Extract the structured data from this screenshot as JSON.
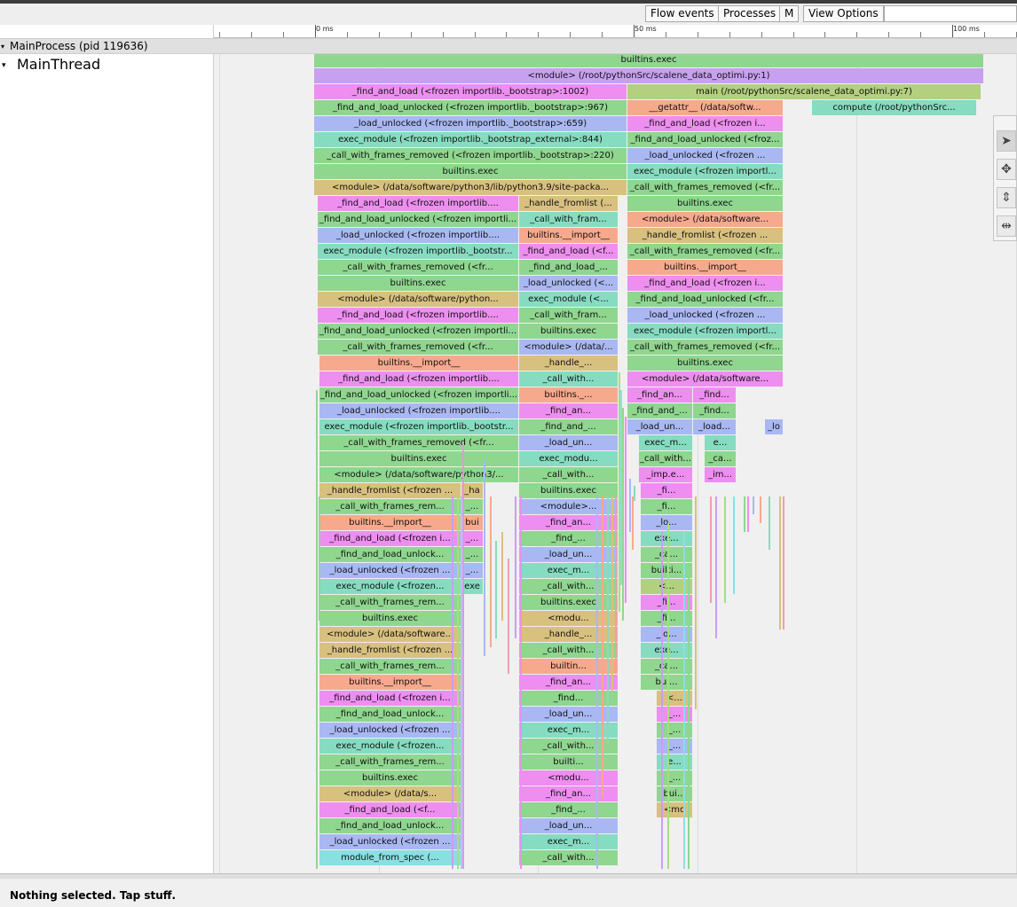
{
  "toolbar": {
    "buttons": [
      "Flow events",
      "Processes",
      "M",
      "View Options"
    ]
  },
  "ruler": {
    "labels": [
      "0 ms",
      "50 ms",
      "100 ms"
    ]
  },
  "process": {
    "label": "MainProcess (pid 119636)"
  },
  "thread": {
    "label": "MainThread"
  },
  "status": {
    "text": "Nothing selected. Tap stuff."
  },
  "tools": [
    "pointer-tool",
    "pan-tool",
    "zoom-tool",
    "timing-tool"
  ],
  "colors": {
    "green": "#8fd68f",
    "purple": "#c7a0f0",
    "magenta": "#ee8ef0",
    "olive": "#b3d07e",
    "salmon": "#f7a98d",
    "blue": "#a9b8f3",
    "teal": "#86dcc0",
    "tan": "#d8c07e",
    "cyan": "#8adfe3",
    "lime": "#a2e07e",
    "pink": "#f29bb3"
  },
  "slices": [
    {
      "t": "builtins.exec",
      "c": "green"
    },
    {
      "t": "<module> (/root/pythonSrc/scalene_data_optimi.py:1)",
      "c": "purple"
    },
    {
      "t": "_find_and_load (<frozen importlib._bootstrap>:1002)",
      "c": "magenta"
    },
    {
      "t": "main (/root/pythonSrc/scalene_data_optimi.py:7)",
      "c": "olive"
    },
    {
      "t": "_find_and_load_unlocked (<frozen importlib._bootstrap>:967)",
      "c": "green"
    },
    {
      "t": "__getattr__ (/data/softw...",
      "c": "salmon"
    },
    {
      "t": "compute (/root/pythonSrc...",
      "c": "teal"
    },
    {
      "t": "_load_unlocked (<frozen importlib._bootstrap>:659)",
      "c": "blue"
    },
    {
      "t": "_find_and_load (<frozen i...",
      "c": "magenta"
    },
    {
      "t": "exec_module (<frozen importlib._bootstrap_external>:844)",
      "c": "teal"
    },
    {
      "t": "_find_and_load_unlocked (<froz...",
      "c": "green"
    },
    {
      "t": "_call_with_frames_removed (<frozen importlib._bootstrap>:220)",
      "c": "green"
    },
    {
      "t": "_load_unlocked (<frozen ...",
      "c": "blue"
    },
    {
      "t": "builtins.exec",
      "c": "green"
    },
    {
      "t": "exec_module (<frozen importl...",
      "c": "teal"
    },
    {
      "t": "<module> (/data/software/python3/lib/python3.9/site-packa...",
      "c": "tan"
    },
    {
      "t": "_call_with_frames_removed (<fr...",
      "c": "green"
    },
    {
      "t": "_find_and_load (<frozen importlib....",
      "c": "magenta"
    },
    {
      "t": "_handle_fromlist (...",
      "c": "tan"
    },
    {
      "t": "builtins.exec",
      "c": "green"
    },
    {
      "t": "_find_and_load_unlocked (<frozen importli...",
      "c": "green"
    },
    {
      "t": "_call_with_fram...",
      "c": "teal"
    },
    {
      "t": "<module> (/data/software...",
      "c": "salmon"
    },
    {
      "t": "_load_unlocked (<frozen importlib....",
      "c": "blue"
    },
    {
      "t": "builtins.__import__",
      "c": "salmon"
    },
    {
      "t": "_handle_fromlist (<frozen ...",
      "c": "tan"
    },
    {
      "t": "exec_module (<frozen importlib._bootstr...",
      "c": "teal"
    },
    {
      "t": "_find_and_load (<f...",
      "c": "magenta"
    },
    {
      "t": "_call_with_frames_removed (<fr...",
      "c": "green"
    },
    {
      "t": "_call_with_frames_removed (<fr...",
      "c": "green"
    },
    {
      "t": "_find_and_load_...",
      "c": "green"
    },
    {
      "t": "builtins.__import__",
      "c": "salmon"
    },
    {
      "t": "builtins.exec",
      "c": "green"
    },
    {
      "t": "_load_unlocked (<...",
      "c": "blue"
    },
    {
      "t": "_find_and_load (<frozen i...",
      "c": "magenta"
    },
    {
      "t": "<module> (/data/software/python...",
      "c": "tan"
    },
    {
      "t": "exec_module (<...",
      "c": "teal"
    },
    {
      "t": "_find_and_load_unlocked (<fr...",
      "c": "green"
    },
    {
      "t": "_find_and_load (<frozen importlib....",
      "c": "magenta"
    },
    {
      "t": "_call_with_fram...",
      "c": "green"
    },
    {
      "t": "_load_unlocked (<frozen ...",
      "c": "blue"
    },
    {
      "t": "_find_and_load_unlocked (<frozen importli...",
      "c": "green"
    },
    {
      "t": "builtins.exec",
      "c": "green"
    },
    {
      "t": "exec_module (<frozen importl...",
      "c": "teal"
    },
    {
      "t": "_call_with_frames_removed (<fr...",
      "c": "green"
    },
    {
      "t": "<module> (/data/...",
      "c": "blue"
    },
    {
      "t": "_call_with_frames_removed (<fr...",
      "c": "green"
    },
    {
      "t": "builtins.__import__",
      "c": "salmon"
    },
    {
      "t": "_handle_...",
      "c": "tan"
    },
    {
      "t": "builtins.exec",
      "c": "green"
    },
    {
      "t": "_find_and_load (<frozen importlib....",
      "c": "magenta"
    },
    {
      "t": "_call_with...",
      "c": "teal"
    },
    {
      "t": "<module> (/data/software...",
      "c": "magenta"
    },
    {
      "t": "_find_and_load_unlocked (<frozen importli...",
      "c": "green"
    },
    {
      "t": "builtins._...",
      "c": "salmon"
    },
    {
      "t": "_find_an...",
      "c": "magenta"
    },
    {
      "t": "_find...",
      "c": "magenta"
    },
    {
      "t": "_load_unlocked (<frozen importlib....",
      "c": "blue"
    },
    {
      "t": "_find_an...",
      "c": "magenta"
    },
    {
      "t": "_find_and_...",
      "c": "green"
    },
    {
      "t": "_find...",
      "c": "green"
    },
    {
      "t": "exec_module (<frozen importlib._bootstr...",
      "c": "teal"
    },
    {
      "t": "_find_and_...",
      "c": "green"
    },
    {
      "t": "_load_un...",
      "c": "blue"
    },
    {
      "t": "_load...",
      "c": "blue"
    },
    {
      "t": "_lo",
      "c": "blue"
    },
    {
      "t": "_call_with_frames_removed (<fr...",
      "c": "green"
    },
    {
      "t": "_load_un...",
      "c": "blue"
    },
    {
      "t": "exec_m...",
      "c": "teal"
    },
    {
      "t": "e...",
      "c": "teal"
    },
    {
      "t": "builtins.exec",
      "c": "green"
    },
    {
      "t": "exec_modu...",
      "c": "teal"
    },
    {
      "t": "_call_with...",
      "c": "green"
    },
    {
      "t": "_ca...",
      "c": "green"
    },
    {
      "t": "<module> (/data/software/python3/...",
      "c": "green"
    },
    {
      "t": "_call_with...",
      "c": "green"
    },
    {
      "t": "_imp.e...",
      "c": "magenta"
    },
    {
      "t": "_im...",
      "c": "magenta"
    },
    {
      "t": "_handle_fromlist (<frozen ...",
      "c": "tan"
    },
    {
      "t": "_ha",
      "c": "tan"
    },
    {
      "t": "builtins.exec",
      "c": "green"
    },
    {
      "t": "_fi...",
      "c": "magenta"
    },
    {
      "t": "_call_with_frames_rem...",
      "c": "green"
    },
    {
      "t": "_...",
      "c": "green"
    },
    {
      "t": "<module>...",
      "c": "blue"
    },
    {
      "t": "_fi...",
      "c": "green"
    },
    {
      "t": "builtins.__import__",
      "c": "salmon"
    },
    {
      "t": "bui",
      "c": "salmon"
    },
    {
      "t": "_find_an...",
      "c": "magenta"
    },
    {
      "t": "_lo...",
      "c": "blue"
    },
    {
      "t": "_find_and_load (<frozen i...",
      "c": "magenta"
    },
    {
      "t": "_...",
      "c": "magenta"
    },
    {
      "t": "_find_...",
      "c": "green"
    },
    {
      "t": "exe...",
      "c": "teal"
    },
    {
      "t": "_find_and_load_unlock...",
      "c": "green"
    },
    {
      "t": "_...",
      "c": "green"
    },
    {
      "t": "_load_un...",
      "c": "blue"
    },
    {
      "t": "_ca...",
      "c": "green"
    },
    {
      "t": "_load_unlocked (<frozen ...",
      "c": "blue"
    },
    {
      "t": "_...",
      "c": "blue"
    },
    {
      "t": "exec_m...",
      "c": "teal"
    },
    {
      "t": "builti...",
      "c": "green"
    },
    {
      "t": "exec_module (<frozen...",
      "c": "teal"
    },
    {
      "t": "exe",
      "c": "teal"
    },
    {
      "t": "_call_with...",
      "c": "green"
    },
    {
      "t": "<...",
      "c": "olive"
    },
    {
      "t": "_call_with_frames_rem...",
      "c": "green"
    },
    {
      "t": "builtins.exec",
      "c": "green"
    },
    {
      "t": "_fi...",
      "c": "magenta"
    },
    {
      "t": "builtins.exec",
      "c": "green"
    },
    {
      "t": "<modu...",
      "c": "tan"
    },
    {
      "t": "_fi...",
      "c": "green"
    },
    {
      "t": "<module> (/data/software...",
      "c": "tan"
    },
    {
      "t": "_handle_...",
      "c": "tan"
    },
    {
      "t": "_lo...",
      "c": "blue"
    },
    {
      "t": "_handle_fromlist (<frozen ...",
      "c": "tan"
    },
    {
      "t": "_call_with...",
      "c": "green"
    },
    {
      "t": "exe...",
      "c": "teal"
    },
    {
      "t": "_call_with_frames_rem...",
      "c": "green"
    },
    {
      "t": "builtin...",
      "c": "salmon"
    },
    {
      "t": "_ca...",
      "c": "green"
    },
    {
      "t": "builtins.__import__",
      "c": "salmon"
    },
    {
      "t": "_find_an...",
      "c": "magenta"
    },
    {
      "t": "bui...",
      "c": "green"
    },
    {
      "t": "_find_and_load (<frozen i...",
      "c": "magenta"
    },
    {
      "t": "_find...",
      "c": "green"
    },
    {
      "t": "<...",
      "c": "tan"
    },
    {
      "t": "_find_and_load_unlock...",
      "c": "green"
    },
    {
      "t": "_load_un...",
      "c": "blue"
    },
    {
      "t": "_...",
      "c": "magenta"
    },
    {
      "t": "_load_unlocked (<frozen ...",
      "c": "blue"
    },
    {
      "t": "exec_m...",
      "c": "teal"
    },
    {
      "t": "_...",
      "c": "green"
    },
    {
      "t": "exec_module (<frozen...",
      "c": "teal"
    },
    {
      "t": "_call_with...",
      "c": "green"
    },
    {
      "t": "_...",
      "c": "blue"
    },
    {
      "t": "_call_with_frames_rem...",
      "c": "green"
    },
    {
      "t": "builti...",
      "c": "green"
    },
    {
      "t": "e...",
      "c": "teal"
    },
    {
      "t": "builtins.exec",
      "c": "green"
    },
    {
      "t": "<modu...",
      "c": "magenta"
    },
    {
      "t": "_...",
      "c": "green"
    },
    {
      "t": "<module> (/data/s...",
      "c": "tan"
    },
    {
      "t": "_find_an...",
      "c": "magenta"
    },
    {
      "t": "bui...",
      "c": "green"
    },
    {
      "t": "_find_and_load (<f...",
      "c": "magenta"
    },
    {
      "t": "_find_...",
      "c": "green"
    },
    {
      "t": "<mo",
      "c": "tan"
    },
    {
      "t": "_find_and_load_unlock...",
      "c": "green"
    },
    {
      "t": "_load_un...",
      "c": "blue"
    },
    {
      "t": "_load_unlocked (<frozen ...",
      "c": "blue"
    },
    {
      "t": "exec_m...",
      "c": "teal"
    },
    {
      "t": "module_from_spec (...",
      "c": "cyan"
    },
    {
      "t": "_call_with...",
      "c": "green"
    }
  ]
}
